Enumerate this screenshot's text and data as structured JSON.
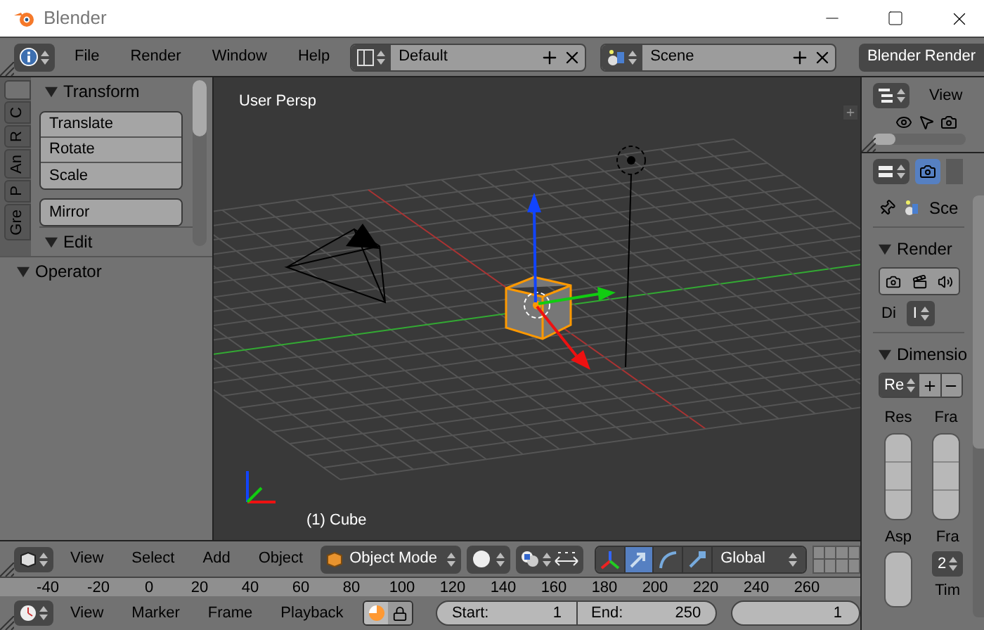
{
  "window": {
    "title": "Blender"
  },
  "info_header": {
    "menus": [
      "File",
      "Render",
      "Window",
      "Help"
    ],
    "layout": "Default",
    "scene": "Scene",
    "engine": "Blender Render"
  },
  "tool_shelf": {
    "tabs": [
      {
        "label": "C",
        "selected": false
      },
      {
        "label": "R",
        "selected": false
      },
      {
        "label": "An",
        "selected": false
      },
      {
        "label": "P",
        "selected": false
      },
      {
        "label": "Gre",
        "selected": false
      }
    ],
    "panels": [
      {
        "title": "Transform",
        "expanded": true,
        "groups": [
          [
            "Translate",
            "Rotate",
            "Scale"
          ],
          [
            "Mirror"
          ]
        ]
      },
      {
        "title": "Edit",
        "expanded": true
      }
    ],
    "operator": {
      "title": "Operator",
      "expanded": true
    }
  },
  "viewport": {
    "view_label": "User Persp",
    "object_label": "(1) Cube"
  },
  "view3d_header": {
    "menus": [
      "View",
      "Select",
      "Add",
      "Object"
    ],
    "mode": "Object Mode",
    "orientation": "Global",
    "manipulators": [
      {
        "kind": "axes",
        "selected": false
      },
      {
        "kind": "translate",
        "selected": true
      },
      {
        "kind": "rotate",
        "selected": false
      },
      {
        "kind": "scale",
        "selected": false
      }
    ]
  },
  "timeline": {
    "ruler": [
      "-40",
      "-20",
      "0",
      "20",
      "40",
      "60",
      "80",
      "100",
      "120",
      "140",
      "160",
      "180",
      "200",
      "220",
      "240",
      "260"
    ],
    "menus": [
      "View",
      "Marker",
      "Frame",
      "Playback"
    ],
    "start_label": "Start:",
    "start": "1",
    "end_label": "End:",
    "end": "250",
    "current": "1"
  },
  "outliner": {
    "view_menu": "View"
  },
  "properties": {
    "scene": "Sce",
    "render_panel": {
      "title": "Render",
      "expanded": true,
      "display_label": "Di",
      "display_value": "I"
    },
    "dimensions_panel": {
      "title": "Dimensio",
      "expanded": true,
      "preset": "Re",
      "resolution_label": "Res",
      "frames_label": "Fra",
      "aspect_label": "Asp",
      "rate_label": "Fra",
      "rate_value": "2",
      "time_label": "Tim"
    }
  }
}
